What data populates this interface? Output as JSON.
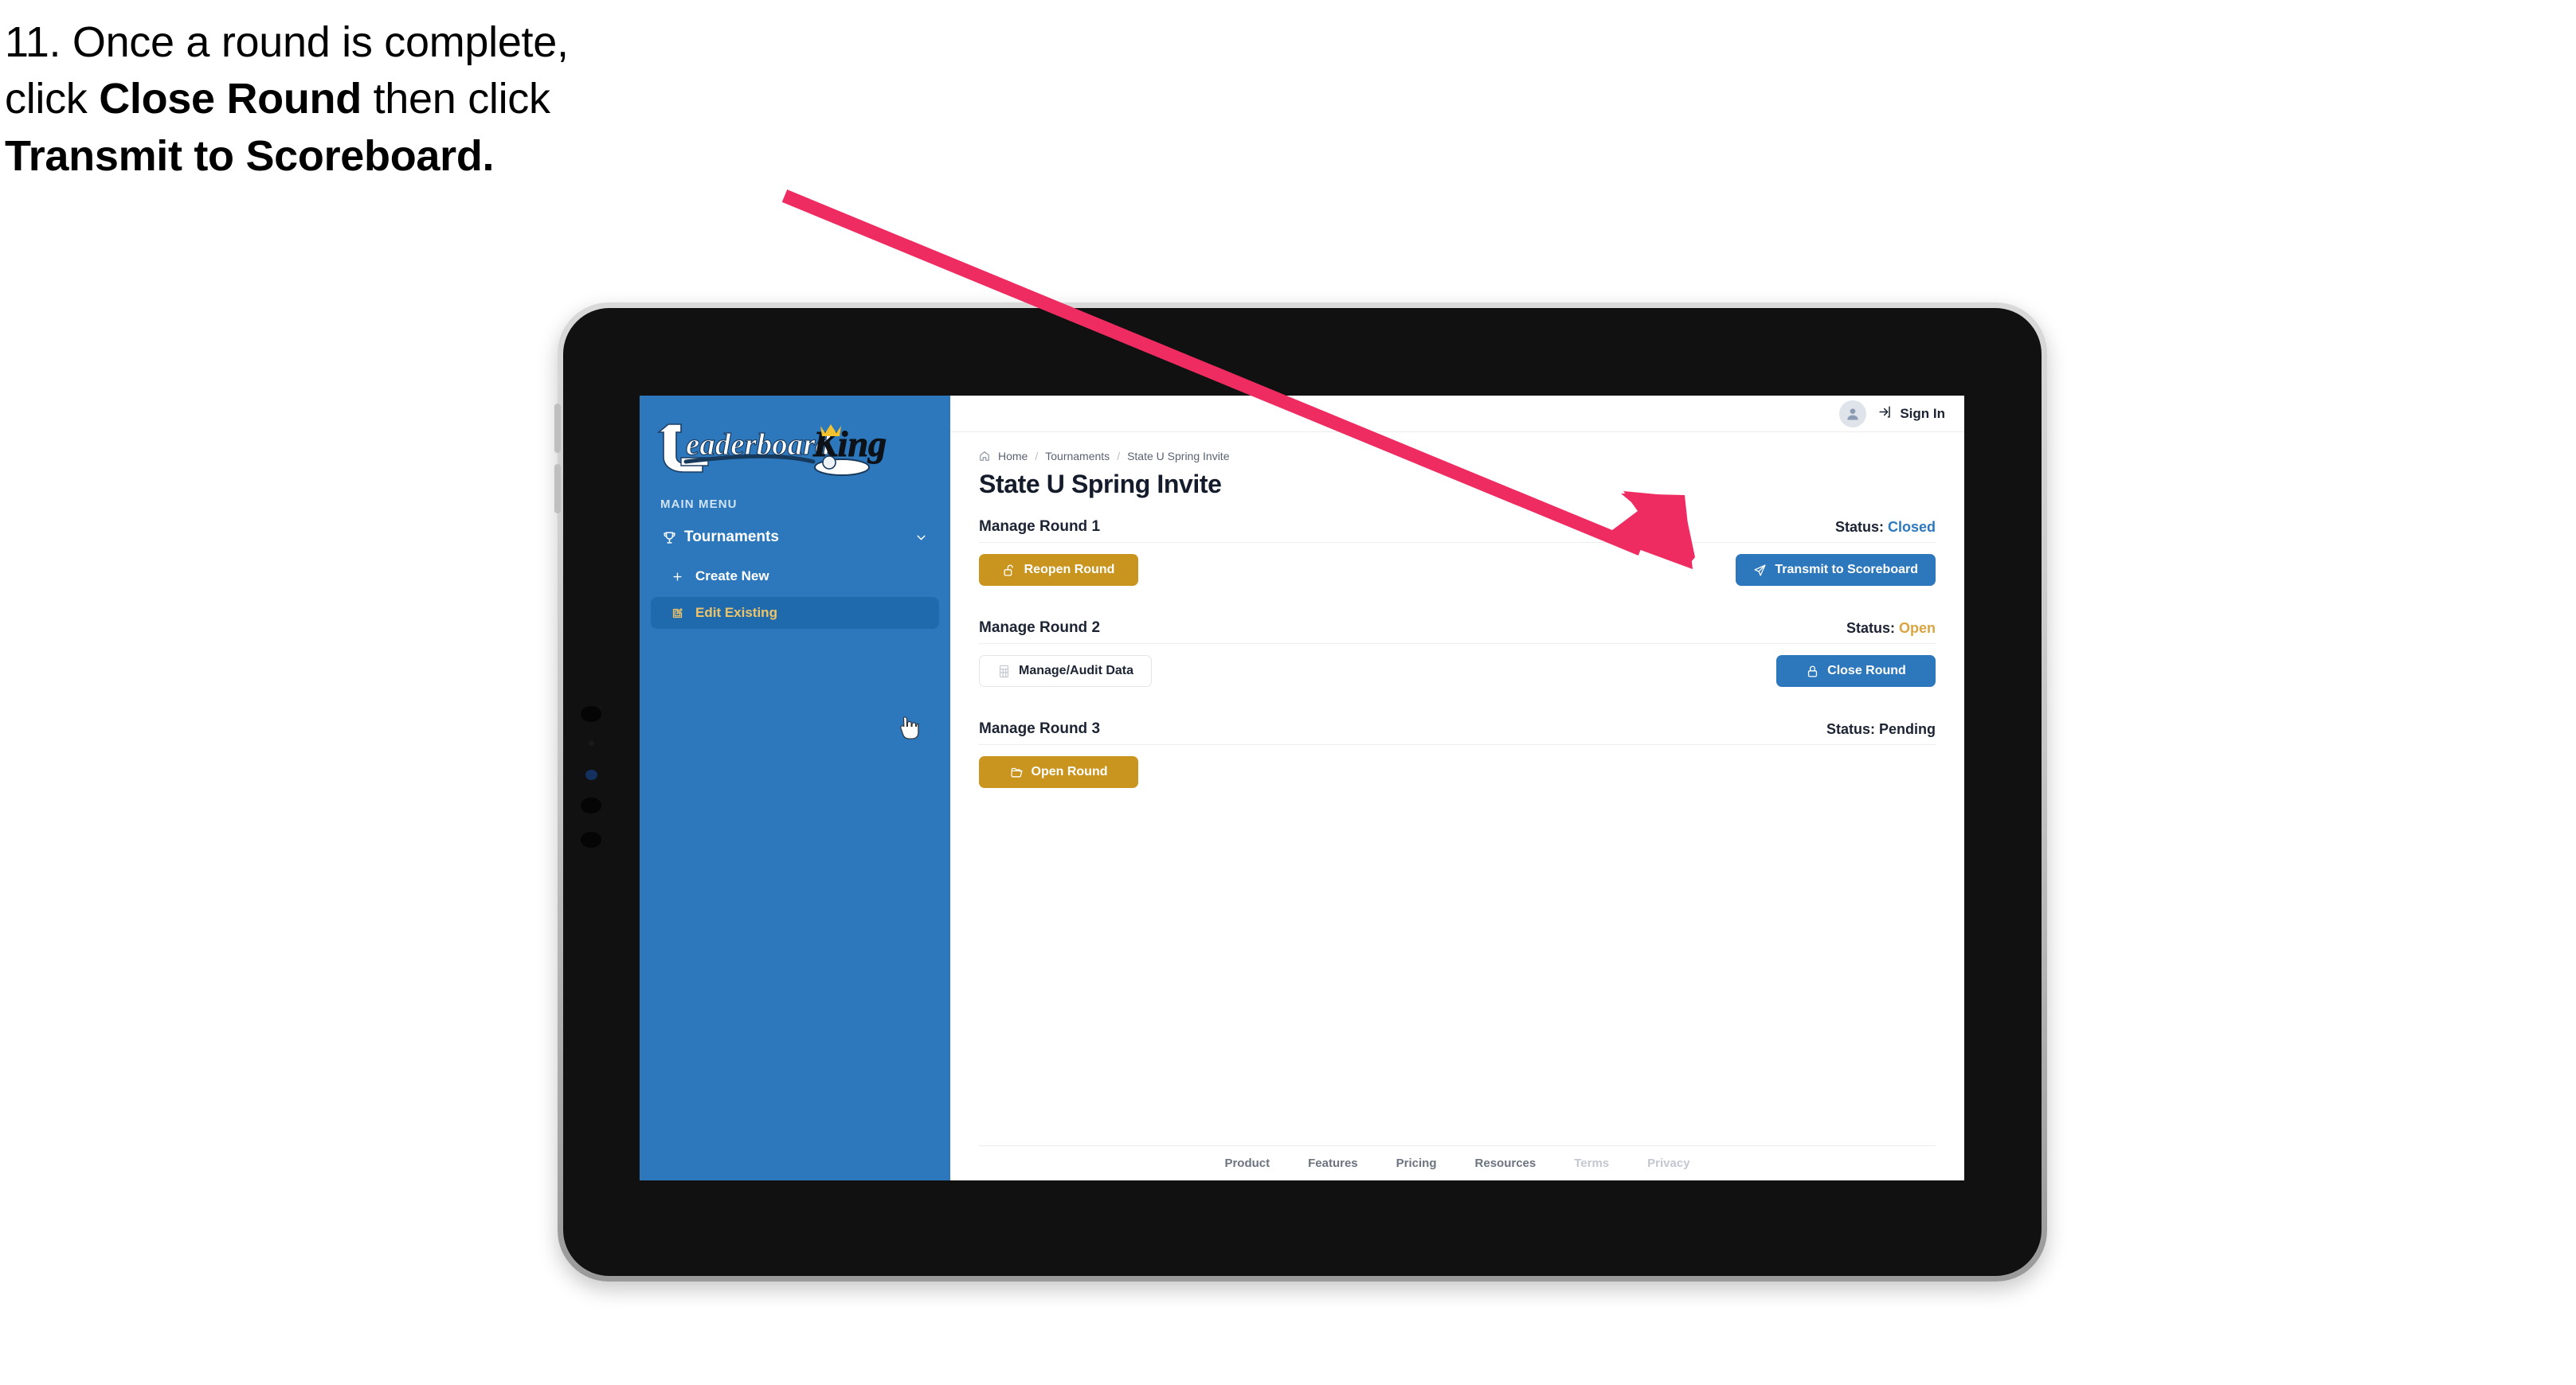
{
  "caption": {
    "line1_plain": "11. Once a round is complete,",
    "line2_pre": "click ",
    "line2_bold": "Close Round",
    "line2_post": " then click",
    "line3_bold": "Transmit to Scoreboard."
  },
  "colors": {
    "sidebar_blue": "#2d78bc",
    "sidebar_active_blue": "#1f6aac",
    "sidebar_active_text": "#edc468",
    "gold": "#ca951e",
    "blue": "#2d78bc",
    "status_closed": "#2d78bc",
    "status_open": "#d9a441",
    "status_pending": "#1c2434",
    "arrow_pink": "#ee2c61",
    "tablet_bezel": "#c6c6c6",
    "tablet_frame": "#111111"
  },
  "sidebar": {
    "logo_primary": "Leaderboard",
    "logo_secondary": "King",
    "section_label": "MAIN MENU",
    "items": [
      {
        "label": "Tournaments",
        "icon": "trophy-icon",
        "chevron": "chevron-down-icon",
        "active": false
      },
      {
        "label": "Create New",
        "icon": "plus-icon",
        "active": false
      },
      {
        "label": "Edit Existing",
        "icon": "edit-square-icon",
        "active": true
      }
    ]
  },
  "topbar": {
    "avatar_icon": "user-avatar-icon",
    "signin_icon": "login-arrow-icon",
    "signin_label": "Sign In"
  },
  "breadcrumb": {
    "home_icon": "home-icon",
    "items": [
      "Home",
      "Tournaments",
      "State U Spring Invite"
    ],
    "separator": "/"
  },
  "page": {
    "title": "State U Spring Invite"
  },
  "rounds": [
    {
      "name": "Manage Round 1",
      "status_label": "Status:",
      "status_value": "Closed",
      "status_color": "#2d78bc",
      "left_button": {
        "label": "Reopen Round",
        "style": "gold",
        "icon": "unlock-icon"
      },
      "right_button": {
        "label": "Transmit to Scoreboard",
        "style": "blue",
        "icon": "send-plane-icon"
      }
    },
    {
      "name": "Manage Round 2",
      "status_label": "Status:",
      "status_value": "Open",
      "status_color": "#d9a441",
      "left_button": {
        "label": "Manage/Audit Data",
        "style": "ghost",
        "icon": "calculator-icon"
      },
      "right_button": {
        "label": "Close Round",
        "style": "blue",
        "icon": "lock-icon"
      }
    },
    {
      "name": "Manage Round 3",
      "status_label": "Status:",
      "status_value": "Pending",
      "status_color": "#1c2434",
      "left_button": {
        "label": "Open Round",
        "style": "gold",
        "icon": "open-folder-icon"
      },
      "right_button": null
    }
  ],
  "footer": {
    "links": [
      {
        "label": "Product",
        "dim": false
      },
      {
        "label": "Features",
        "dim": false
      },
      {
        "label": "Pricing",
        "dim": false
      },
      {
        "label": "Resources",
        "dim": false
      },
      {
        "label": "Terms",
        "dim": true
      },
      {
        "label": "Privacy",
        "dim": true
      }
    ]
  },
  "annotation": {
    "arrow_name": "pointer-arrow",
    "target": "Transmit to Scoreboard"
  }
}
